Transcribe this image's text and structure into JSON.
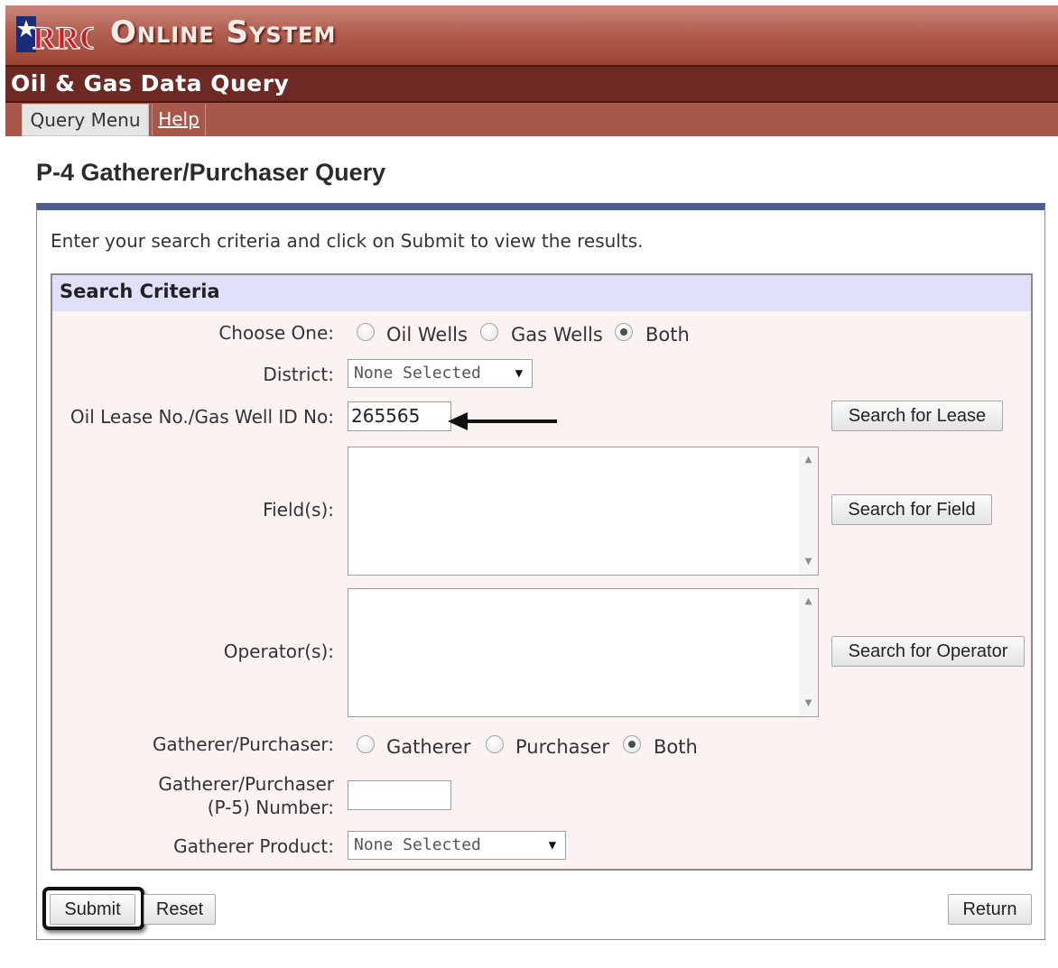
{
  "header": {
    "logo_alt": "RRC",
    "system_title": "Online System",
    "app_subtitle": "Oil & Gas Data Query",
    "nav": {
      "query_menu": "Query Menu",
      "help": "Help"
    }
  },
  "page": {
    "title": "P-4 Gatherer/Purchaser Query",
    "instructions": "Enter your search criteria and click on Submit to view the results."
  },
  "criteria": {
    "title": "Search Criteria",
    "choose_one": {
      "label": "Choose One:",
      "options": [
        "Oil Wells",
        "Gas Wells",
        "Both"
      ],
      "selected": "Both"
    },
    "district": {
      "label": "District:",
      "value": "None Selected"
    },
    "lease": {
      "label": "Oil Lease No./Gas Well ID No:",
      "value": "265565",
      "search_button": "Search for Lease"
    },
    "fields": {
      "label": "Field(s):",
      "search_button": "Search for Field"
    },
    "operators": {
      "label": "Operator(s):",
      "search_button": "Search for Operator"
    },
    "gatherer_purchaser": {
      "label": "Gatherer/Purchaser:",
      "options": [
        "Gatherer",
        "Purchaser",
        "Both"
      ],
      "selected": "Both"
    },
    "p5_number": {
      "label_line1": "Gatherer/Purchaser",
      "label_line2": "(P-5) Number:",
      "value": ""
    },
    "gatherer_product": {
      "label": "Gatherer Product:",
      "value": "None Selected"
    }
  },
  "actions": {
    "submit": "Submit",
    "reset": "Reset",
    "return": "Return"
  },
  "colors": {
    "title_bar": "#b25f50",
    "subtitle_bar": "#6d2a24",
    "panel_accent": "#4a5e8f",
    "criteria_header": "#e0e0fb",
    "criteria_bg": "#fbf3f2"
  },
  "icons": [
    "rrc-texas-logo",
    "dropdown-caret-icon",
    "scroll-up-icon",
    "scroll-down-icon",
    "annotation-arrow-icon"
  ]
}
